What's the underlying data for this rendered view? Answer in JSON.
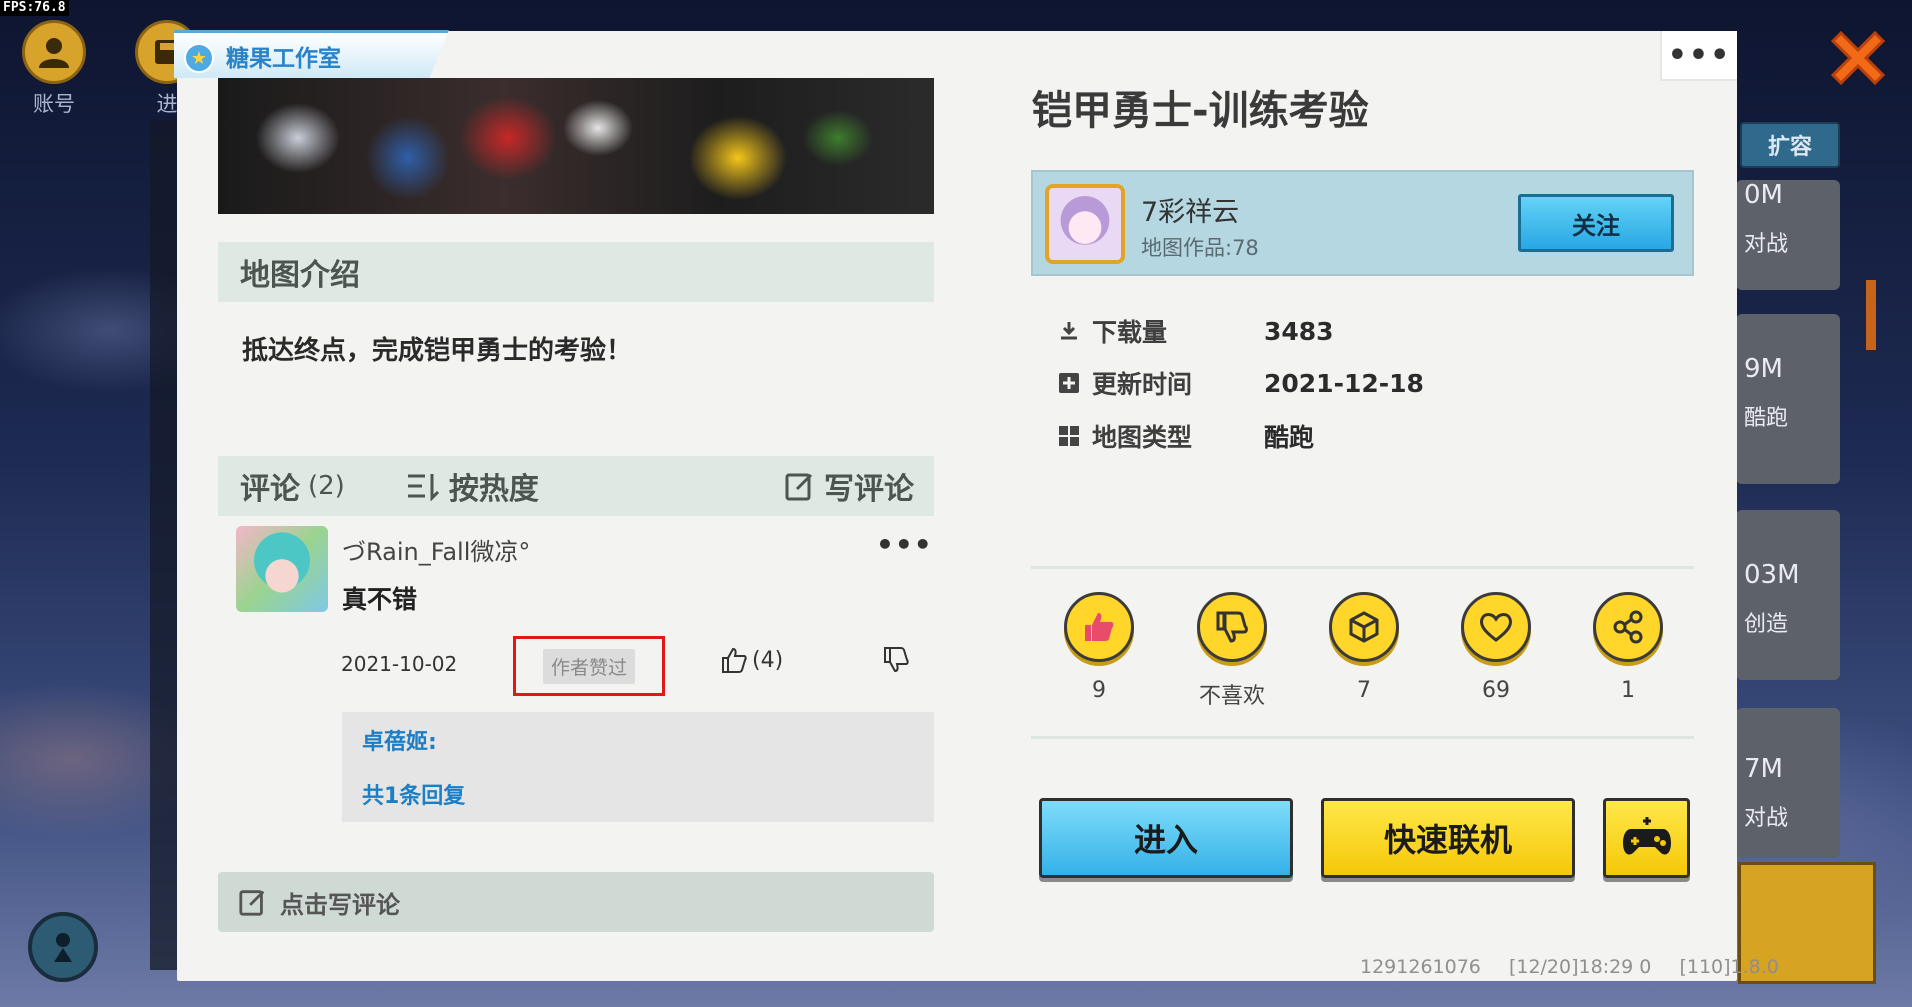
{
  "fps": "FPS:76.8",
  "sidebar": {
    "account_label": "账号",
    "progress_label": "进"
  },
  "background": {
    "expand_label": "扩容",
    "cards": [
      {
        "size": "0M",
        "type": "对战"
      },
      {
        "size": "9M",
        "type": "酷跑"
      },
      {
        "size": "03M",
        "type": "创造"
      },
      {
        "size": "7M",
        "type": "对战"
      }
    ]
  },
  "studio": {
    "name": "糖果工作室"
  },
  "intro": {
    "header": "地图介绍",
    "text": "抵达终点，完成铠甲勇士的考验！"
  },
  "comments": {
    "title": "评论",
    "count": "(2)",
    "sort_label": "按热度",
    "write_label": "写评论",
    "items": [
      {
        "user": "づRain_Fall微凉°",
        "text": "真不错",
        "date": "2021-10-02",
        "tag": "作者赞过",
        "likes": "(4)",
        "reply": {
          "name": "卓蓓姬:",
          "count": "共1条回复"
        }
      }
    ],
    "write_bar_label": "点击写评论"
  },
  "map": {
    "title": "铠甲勇士-训练考验",
    "menu_icon": "•••",
    "author": {
      "name": "7彩祥云",
      "works": "地图作品:78",
      "follow_label": "关注"
    },
    "info": {
      "downloads_label": "下载量",
      "downloads": "3483",
      "updated_label": "更新时间",
      "updated": "2021-12-18",
      "type_label": "地图类型",
      "type": "酷跑"
    },
    "stats": {
      "likes": "9",
      "dislike_label": "不喜欢",
      "collect": "7",
      "favorites": "69",
      "shares": "1"
    },
    "buttons": {
      "enter": "进入",
      "quickplay": "快速联机"
    }
  },
  "footer": {
    "id": "1291261076",
    "time": "[12/20]18:29 0",
    "version": "[110]1.8.0"
  },
  "colors": {
    "accent_blue": "#27a7e3",
    "accent_yellow": "#f5c808",
    "highlight_red": "#e01818",
    "link_blue": "#1c7fc6"
  }
}
